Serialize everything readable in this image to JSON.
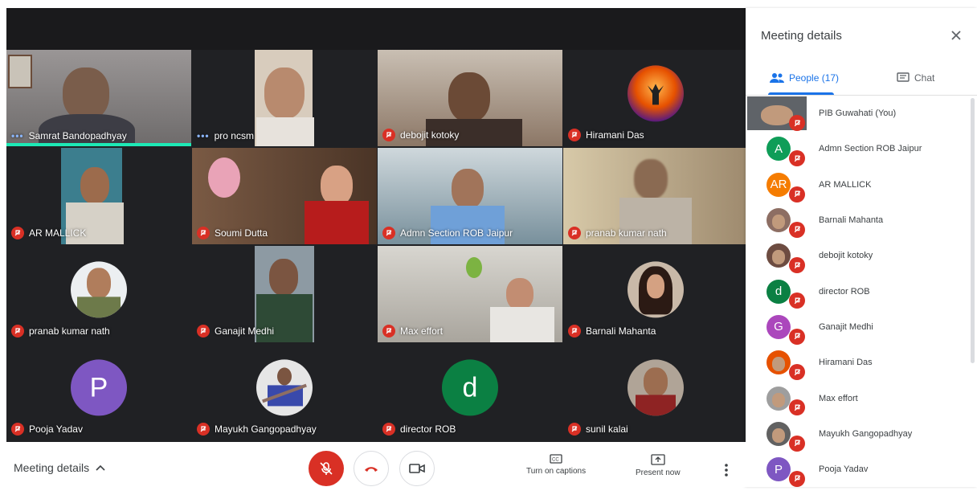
{
  "panel": {
    "title": "Meeting details",
    "tabs": {
      "people": "People (17)",
      "chat": "Chat"
    }
  },
  "participants_list": [
    {
      "name": "PIB Guwahati (You)",
      "initial": "",
      "color": "#5f6368"
    },
    {
      "name": "Admn Section ROB Jaipur",
      "initial": "A",
      "color": "#0f9d58"
    },
    {
      "name": "AR MALLICK",
      "initial": "AR",
      "color": "#f57c00"
    },
    {
      "name": "Barnali Mahanta",
      "initial": "",
      "color": "#8d6e63"
    },
    {
      "name": "debojit kotoky",
      "initial": "",
      "color": "#6d4c41"
    },
    {
      "name": "director ROB",
      "initial": "d",
      "color": "#0b8043"
    },
    {
      "name": "Ganajit Medhi",
      "initial": "G",
      "color": "#ab47bc"
    },
    {
      "name": "Hiramani Das",
      "initial": "",
      "color": "#e65100"
    },
    {
      "name": "Max effort",
      "initial": "",
      "color": "#9e9e9e"
    },
    {
      "name": "Mayukh Gangopadhyay",
      "initial": "",
      "color": "#616161"
    },
    {
      "name": "Pooja Yadav",
      "initial": "P",
      "color": "#7e57c2"
    }
  ],
  "tiles": [
    {
      "name": "Samrat Bandopadhyay",
      "dots": "•••",
      "bg": "#6d6a6a"
    },
    {
      "name": "pro ncsm",
      "dots": "•••",
      "bg": "#b9a48c"
    },
    {
      "name": "debojit kotoky",
      "bg": "#a58b7a"
    },
    {
      "name": "Hiramani Das",
      "bg": "#202124"
    },
    {
      "name": "AR MALLICK",
      "bg": "#2a3d4a"
    },
    {
      "name": "Soumi Dutta",
      "bg": "#6b4a3a"
    },
    {
      "name": "Admn Section ROB Jaipur",
      "bg": "#7f9aa6"
    },
    {
      "name": "pranab kumar nath",
      "bg": "#c5b39a"
    },
    {
      "name": "pranab kumar nath",
      "bg": "#202124"
    },
    {
      "name": "Ganajit Medhi",
      "bg": "#202124"
    },
    {
      "name": "Max effort",
      "bg": "#b5b2ac"
    },
    {
      "name": "Barnali Mahanta",
      "bg": "#202124"
    },
    {
      "name": "Pooja Yadav",
      "initial": "P",
      "color": "#7e57c2"
    },
    {
      "name": "Mayukh Gangopadhyay",
      "bg": "#202124"
    },
    {
      "name": "director ROB",
      "initial": "d",
      "color": "#0b8043"
    },
    {
      "name": "sunil kalai",
      "bg": "#202124"
    }
  ],
  "bottom": {
    "meeting_details": "Meeting details",
    "captions": "Turn on captions",
    "present": "Present now"
  },
  "colors": {
    "accent": "#1a73e8",
    "danger": "#d93025",
    "speaking": "#1de9b6"
  }
}
